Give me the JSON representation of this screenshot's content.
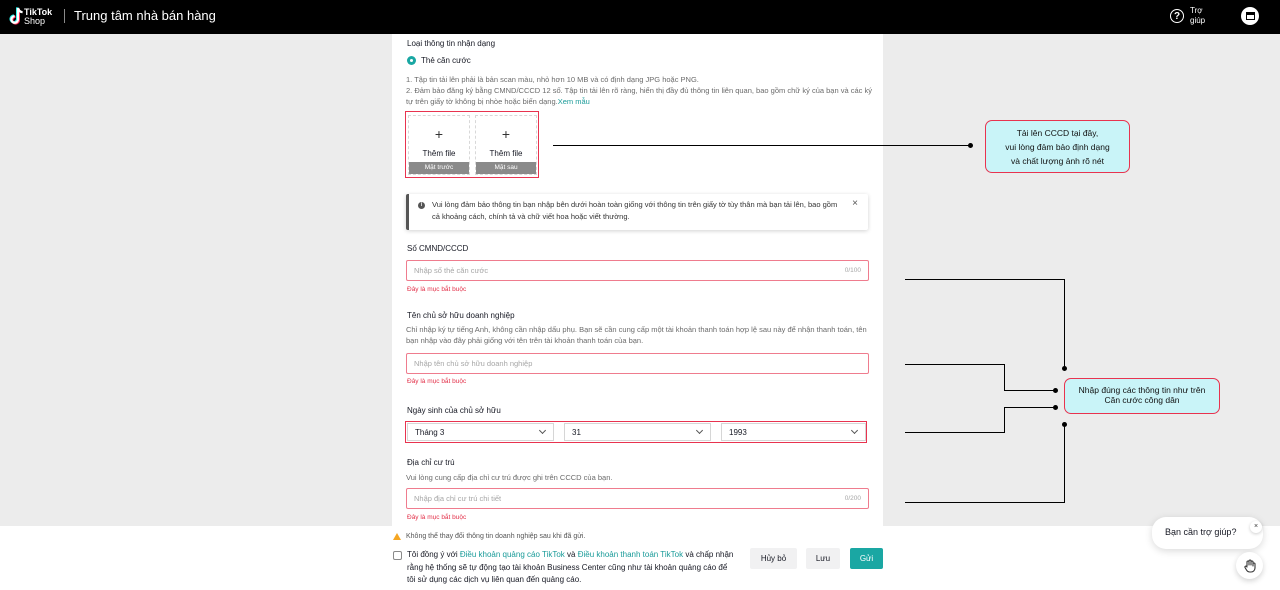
{
  "header": {
    "brand_line1": "TikTok",
    "brand_line2": "Shop",
    "title": "Trung tâm nhà bán hàng",
    "help_label": "Trợ giúp"
  },
  "form": {
    "id_type_label": "Loại thông tin nhận dạng",
    "id_type_option": "Thẻ căn cước",
    "upload_instructions_1": "1. Tập tin tải lên phải là bản scan màu, nhỏ hơn 10 MB và có định dạng JPG hoặc PNG.",
    "upload_instructions_2": "2. Đảm bảo đăng ký bằng CMND/CCCD 12 số. Tập tin tải lên rõ ràng, hiển thị đầy đủ thông tin liên quan, bao gồm chữ ký của bạn và các ký tự trên giấy tờ không bị nhòe hoặc biến dạng.",
    "sample_link": "Xem mẫu",
    "upload_front": {
      "add_label": "Thêm file",
      "caption": "Mặt trước"
    },
    "upload_back": {
      "add_label": "Thêm file",
      "caption": "Mặt sau"
    },
    "notice_text": "Vui lòng đảm bảo thông tin bạn nhập bên dưới hoàn toàn giống với thông tin trên giấy tờ tùy thân mà bạn tải lên, bao gồm cả khoảng cách, chính tả và chữ viết hoa hoặc viết thường.",
    "id_number": {
      "label": "Số CMND/CCCD",
      "placeholder": "Nhập số thẻ căn cước",
      "counter": "0/100",
      "error": "Đây là mục bắt buộc"
    },
    "owner_name": {
      "label": "Tên chủ sở hữu doanh nghiệp",
      "hint": "Chỉ nhập ký tự tiếng Anh, không cần nhập dấu phụ. Bạn sẽ cần cung cấp một tài khoản thanh toán hợp lệ sau này để nhận thanh toán, tên bạn nhập vào đây phải giống với tên trên tài khoản thanh toán của bạn.",
      "placeholder": "Nhập tên chủ sở hữu doanh nghiệp",
      "error": "Đây là mục bắt buộc"
    },
    "birthday": {
      "label": "Ngày sinh của chủ sở hữu",
      "month": "Tháng 3",
      "day": "31",
      "year": "1993"
    },
    "address": {
      "label": "Địa chỉ cư trú",
      "hint": "Vui lòng cung cấp địa chỉ cư trú được ghi trên CCCD của bạn.",
      "placeholder": "Nhập địa chỉ cư trú chi tiết",
      "counter": "0/200",
      "error": "Đây là mục bắt buộc"
    }
  },
  "footer": {
    "warning": "Không thể thay đổi thông tin doanh nghiệp sau khi đã gửi.",
    "agree_prefix": "Tôi đồng ý với ",
    "terms_ads": "Điều khoản quảng cáo TikTok",
    "agree_and": " và ",
    "terms_payment": "Điều khoản thanh toán TikTok",
    "agree_suffix": " và chấp nhận rằng hệ thống sẽ tự động tạo tài khoản Business Center cũng như tài khoản quảng cáo để tôi sử dụng các dịch vụ liên quan đến quảng cáo.",
    "cancel_label": "Hủy bỏ",
    "save_label": "Lưu",
    "submit_label": "Gửi"
  },
  "annotations": {
    "upload_note_1": "Tải lên CCCD tại đây,",
    "upload_note_2": "vui lòng đảm bảo định dạng",
    "upload_note_3": "và chất lượng ảnh rõ nét",
    "info_note_1": "Nhập đúng các thông tin như trên",
    "info_note_2": "Căn cước công dân"
  },
  "help_bubble": {
    "question": "Bạn cần trợ giúp?",
    "close": "×"
  },
  "colors": {
    "accent": "#1aa7a3",
    "error": "#e3314a",
    "annotation_fill": "#c9f4f8",
    "annotation_border": "#e8334f"
  },
  "icons": [
    "tiktok-logo-icon",
    "help-circle-icon",
    "store-icon",
    "info-icon",
    "close-icon",
    "chevron-down-icon",
    "warning-icon",
    "hand-icon"
  ]
}
